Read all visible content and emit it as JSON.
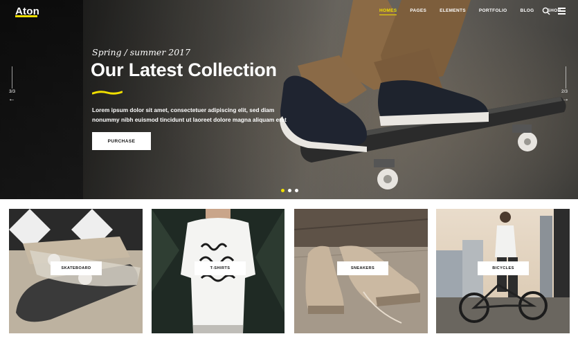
{
  "header": {
    "logo": "Aton",
    "nav": [
      {
        "label": "HOMES",
        "active": true
      },
      {
        "label": "PAGES",
        "active": false
      },
      {
        "label": "ELEMENTS",
        "active": false
      },
      {
        "label": "PORTFOLIO",
        "active": false
      },
      {
        "label": "BLOG",
        "active": false
      },
      {
        "label": "SHOP",
        "active": false
      }
    ],
    "icons": [
      "search-icon",
      "menu-icon"
    ]
  },
  "hero": {
    "subtitle": "Spring / summer 2017",
    "title": "Our Latest Collection",
    "description": "Lorem ipsum dolor sit amet, consectetuer adipiscing elit, sed diam nonummy nibh euismod tincidunt ut laoreet dolore magna aliquam erat",
    "button": "PURCHASE",
    "prev_count": "3/3",
    "next_count": "2/3",
    "active_slide": 1,
    "slides_total": 3
  },
  "categories": [
    {
      "label": "SKATEBOARD"
    },
    {
      "label": "T-SHIRTS"
    },
    {
      "label": "SNEAKERS"
    },
    {
      "label": "BICYCLES"
    }
  ],
  "colors": {
    "accent": "#f1e000",
    "text_light": "#ffffff",
    "text_dark": "#111111"
  }
}
